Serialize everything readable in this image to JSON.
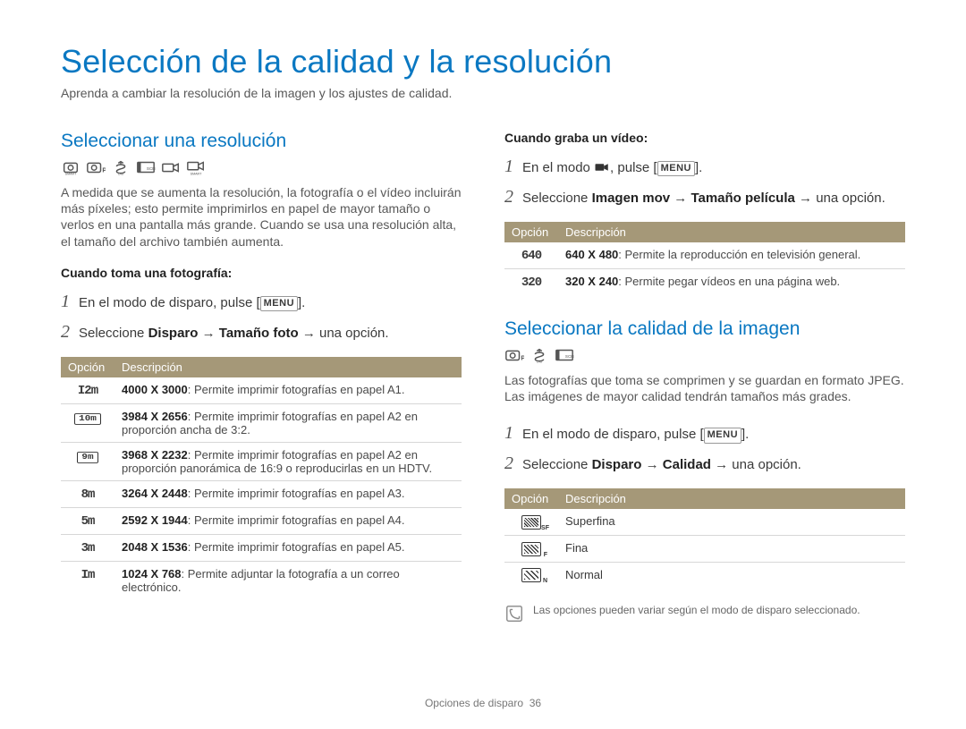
{
  "title": "Selección de la calidad y la resolución",
  "intro": "Aprenda a cambiar la resolución de la imagen y los ajustes de calidad.",
  "left": {
    "h2": "Seleccionar una resolución",
    "para": "A medida que se aumenta la resolución, la fotografía o el vídeo incluirán más píxeles; esto permite imprimirlos en papel de mayor tamaño o verlos en una pantalla más grande. Cuando se usa una resolución alta, el tamaño del archivo también aumenta.",
    "subhead": "Cuando toma una fotografía:",
    "step1_pre": "En el modo de disparo, pulse [",
    "step1_btn": "MENU",
    "step1_post": "].",
    "step2_pre": "Seleccione ",
    "step2_b1": "Disparo",
    "step2_arrow1": " → ",
    "step2_b2": "Tamaño foto",
    "step2_arrow2": " → una opción.",
    "table_h1": "Opción",
    "table_h2": "Descripción",
    "rows": [
      {
        "opt": "12m",
        "bold": "4000 X 3000",
        "rest": ": Permite imprimir fotografías en papel A1."
      },
      {
        "opt": "10mw",
        "bold": "3984 X 2656",
        "rest": ": Permite imprimir fotografías en papel A2 en proporción ancha de 3:2."
      },
      {
        "opt": "9mw",
        "bold": "3968 X 2232",
        "rest": ": Permite imprimir fotografías en papel A2 en proporción panorámica de 16:9 o reproducirlas en un HDTV."
      },
      {
        "opt": "8m",
        "bold": "3264 X 2448",
        "rest": ": Permite imprimir fotografías en papel A3."
      },
      {
        "opt": "5m",
        "bold": "2592 X 1944",
        "rest": ": Permite imprimir fotografías en papel A4."
      },
      {
        "opt": "3m",
        "bold": "2048 X 1536",
        "rest": ": Permite imprimir fotografías en papel A5."
      },
      {
        "opt": "1m",
        "bold": "1024 X 768",
        "rest": ": Permite adjuntar la fotografía a un correo electrónico."
      }
    ]
  },
  "right": {
    "subhead_video": "Cuando graba un vídeo:",
    "vstep1_pre": "En el modo ",
    "vstep1_mid": ", pulse [",
    "vstep1_btn": "MENU",
    "vstep1_post": "].",
    "vstep2_pre": "Seleccione ",
    "vstep2_b1": "Imagen mov",
    "vstep2_arrow1": " → ",
    "vstep2_b2": "Tamaño película",
    "vstep2_arrow2": " → una opción.",
    "vtable_h1": "Opción",
    "vtable_h2": "Descripción",
    "vrows": [
      {
        "opt": "640",
        "bold": "640 X 480",
        "rest": ": Permite la reproducción en televisión general."
      },
      {
        "opt": "320",
        "bold": "320 X 240",
        "rest": ": Permite pegar vídeos en una página web."
      }
    ],
    "h2q": "Seleccionar la calidad de la imagen",
    "paraq": "Las fotografías que toma se comprimen y se guardan en formato JPEG. Las imágenes de mayor calidad tendrán tamaños más grades.",
    "qstep1_pre": "En el modo de disparo, pulse [",
    "qstep1_btn": "MENU",
    "qstep1_post": "].",
    "qstep2_pre": "Seleccione ",
    "qstep2_b1": "Disparo",
    "qstep2_arrow1": " → ",
    "qstep2_b2": "Calidad",
    "qstep2_arrow2": " → una opción.",
    "qtable_h1": "Opción",
    "qtable_h2": "Descripción",
    "qrows": [
      {
        "opt": "sf",
        "label": "Superfina"
      },
      {
        "opt": "f",
        "label": "Fina"
      },
      {
        "opt": "n",
        "label": "Normal"
      }
    ],
    "note": "Las opciones pueden variar según el modo de disparo seleccionado."
  },
  "footer_label": "Opciones de disparo",
  "footer_page": "36"
}
